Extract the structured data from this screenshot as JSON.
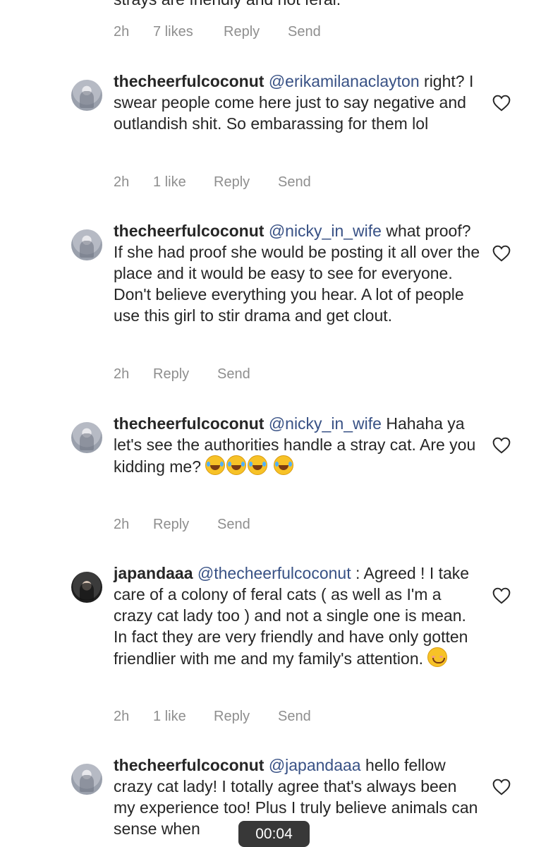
{
  "top_fragment": {
    "text": "strays are friendly and not feral.",
    "time": "2h",
    "likes": "7 likes",
    "reply": "Reply",
    "send": "Send"
  },
  "comments": [
    {
      "username": "thecheerfulcoconut",
      "mention": "@erikamilanaclayton",
      "body": "right? I swear people come here just to say negative and outlandish shit. So embarassing for them lol",
      "time": "2h",
      "likes": "1 like",
      "reply": "Reply",
      "send": "Send"
    },
    {
      "username": "thecheerfulcoconut",
      "mention": "@nicky_in_wife",
      "body": "what proof? If she had proof she would be posting it all over the place and it would be easy to see for everyone. Don't believe everything you hear. A lot of people use this girl to stir drama and get clout.",
      "time": "2h",
      "reply": "Reply",
      "send": "Send"
    },
    {
      "username": "thecheerfulcoconut",
      "mention": "@nicky_in_wife",
      "body": "Hahaha ya let's see the authorities handle a stray cat. Are you kidding me?",
      "emojis": [
        "face-with-tears-of-joy",
        "face-with-tears-of-joy",
        "face-with-tears-of-joy",
        "face-with-tears-of-joy"
      ],
      "time": "2h",
      "reply": "Reply",
      "send": "Send"
    },
    {
      "username": "japandaaa",
      "mention": "@thecheerfulcoconut",
      "body": ": Agreed ! I take care of a colony of feral cats ( as well as I'm a crazy cat lady too ) and not a single one is mean. In fact they are very friendly and have only gotten friendlier with me and my family's attention.",
      "emojis": [
        "smiling-face-with-smiling-eyes"
      ],
      "time": "2h",
      "likes": "1 like",
      "reply": "Reply",
      "send": "Send"
    },
    {
      "username": "thecheerfulcoconut",
      "mention": "@japandaaa",
      "body": "hello fellow crazy cat lady! I totally agree that's always been my experience too! Plus I truly believe animals can sense when"
    }
  ],
  "video_timer": "00:04",
  "icons": {
    "like": "heart-outline-icon",
    "avatar": "profile-avatar"
  },
  "colors": {
    "mention": "#385185",
    "meta": "#8e8e8e",
    "text": "#262626"
  }
}
